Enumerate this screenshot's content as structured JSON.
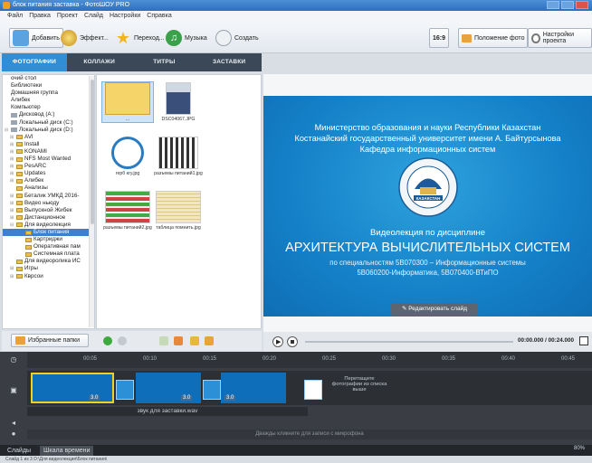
{
  "window": {
    "title": "блок питания заставка - ФотоШОУ PRO"
  },
  "menu": [
    "Файл",
    "Правка",
    "Проект",
    "Слайд",
    "Настройки",
    "Справка"
  ],
  "toolbar": {
    "add": "Добавить",
    "effects": "Эффект...",
    "transitions": "Переход...",
    "music": "Музыка",
    "create": "Создать",
    "ratio": "16:9",
    "photo_position": "Положение фото",
    "project_settings": "Настройки проекта"
  },
  "tabs": [
    "ФОТОГРАФИИ",
    "КОЛЛАЖИ",
    "ТИТРЫ",
    "ЗАСТАВКИ"
  ],
  "tree": [
    {
      "label": "очий стол",
      "icon": "none",
      "exp": ""
    },
    {
      "label": "Библиотеки",
      "icon": "none",
      "exp": ""
    },
    {
      "label": "Домашняя группа",
      "icon": "none",
      "exp": ""
    },
    {
      "label": "Алибек",
      "icon": "none",
      "exp": ""
    },
    {
      "label": "Компьютер",
      "icon": "none",
      "exp": ""
    },
    {
      "label": "Дисковод (A:)",
      "icon": "drive",
      "exp": ""
    },
    {
      "label": "Локальный диск (C:)",
      "icon": "drive",
      "exp": ""
    },
    {
      "label": "Локальный диск (D:)",
      "icon": "drive",
      "exp": "⊟"
    },
    {
      "label": "AVI",
      "icon": "folder",
      "exp": "⊞"
    },
    {
      "label": "Install",
      "icon": "folder",
      "exp": "⊞"
    },
    {
      "label": "KONAMI",
      "icon": "folder",
      "exp": "⊞"
    },
    {
      "label": "NFS Most Wanted",
      "icon": "folder",
      "exp": "⊞"
    },
    {
      "label": "PesARC",
      "icon": "folder",
      "exp": "⊞"
    },
    {
      "label": "Updates",
      "icon": "folder",
      "exp": "⊞"
    },
    {
      "label": "Алибек",
      "icon": "folder",
      "exp": "⊞"
    },
    {
      "label": "Анализы",
      "icon": "folder",
      "exp": ""
    },
    {
      "label": "Беталик УМКД 2016-",
      "icon": "folder",
      "exp": "⊞"
    },
    {
      "label": "Видео ньюду",
      "icon": "folder",
      "exp": "⊞"
    },
    {
      "label": "Выпускной Жибек",
      "icon": "folder",
      "exp": "⊞"
    },
    {
      "label": "Дистанционное",
      "icon": "folder",
      "exp": "⊞"
    },
    {
      "label": "Для видеолекция",
      "icon": "folder",
      "exp": "⊟"
    },
    {
      "label": "Блок питания",
      "icon": "folder",
      "exp": "",
      "selected": true,
      "indent": 1
    },
    {
      "label": "Картриджи",
      "icon": "folder",
      "exp": "",
      "indent": 1
    },
    {
      "label": "Оперативная пам",
      "icon": "folder",
      "exp": "",
      "indent": 1
    },
    {
      "label": "Системная плата",
      "icon": "folder",
      "exp": "",
      "indent": 1
    },
    {
      "label": "Для видеоролика ИС",
      "icon": "folder",
      "exp": ""
    },
    {
      "label": "Игры",
      "icon": "folder",
      "exp": "⊞"
    },
    {
      "label": "Кврсои",
      "icon": "folder",
      "exp": "⊞"
    }
  ],
  "files": [
    {
      "label": "...",
      "kind": "folder"
    },
    {
      "label": "DSC04067.JPG",
      "kind": "portrait"
    },
    {
      "label": "герб кгу.jpg",
      "kind": "emblem"
    },
    {
      "label": "разъемы питаний1.jpg",
      "kind": "connectors"
    },
    {
      "label": "разъемы питаний2.jpg",
      "kind": "table"
    },
    {
      "label": "таблица помнить.jpg",
      "kind": "doc"
    }
  ],
  "favorites": "Избранные папки",
  "slide": {
    "line1": "Министерство образования и науки Республики Казахстан",
    "line2": "Костанайский государственный университет имени А. Байтурсынова",
    "line3": "Кафедра информационных систем",
    "line4": "Видеолекция по дисциплине",
    "title": "АРХИТЕКТУРА ВЫЧИСЛИТЕЛЬНЫХ СИСТЕМ",
    "line5": "по специальностям 5В070300 – Информационные системы",
    "line6": "5В060200-Информатика, 5В070400-ВТиПО",
    "emblem_text": "КАЗАКСТАН"
  },
  "edit_slide": "Редактировать слайд",
  "player": {
    "time": "00:00.000 / 00:24.000"
  },
  "timeline": {
    "ruler": [
      "00:05",
      "00:10",
      "00:15",
      "00:20",
      "00:25",
      "00:30",
      "00:35",
      "00:40",
      "00:45"
    ],
    "clip_durations": [
      "3.0",
      "3.0",
      "3.0"
    ],
    "drop_hint": "Перетащите фотографии из списка выше",
    "audio": "звук для заставки.wav",
    "voice": "Дважды кликните для записи с микрофона"
  },
  "modes": [
    "Слайды",
    "Шкала времени"
  ],
  "zoom": "80%",
  "status": "Слайд 1 из 3        D:\\Для видеолекция\\Блок питания\\"
}
